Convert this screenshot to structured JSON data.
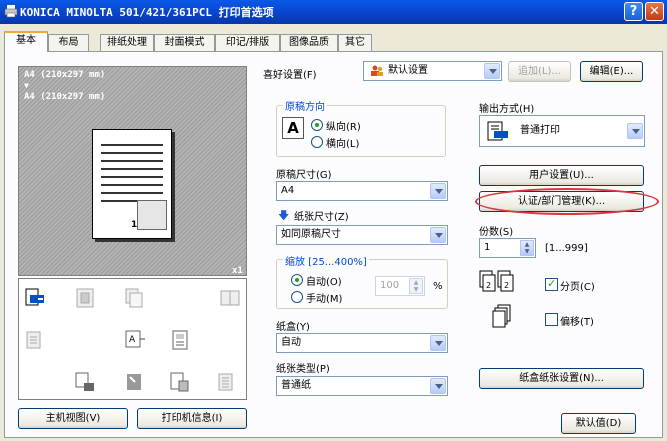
{
  "window": {
    "title": "KONICA MINOLTA 501/421/361PCL 打印首选项",
    "help_label": "?",
    "close_label": "✕"
  },
  "tabs": [
    {
      "label": "基本",
      "active": true
    },
    {
      "label": "布局"
    },
    {
      "label": "排纸处理"
    },
    {
      "label": "封面模式"
    },
    {
      "label": "印记/排版"
    },
    {
      "label": "图像品质"
    },
    {
      "label": "其它"
    }
  ],
  "preview": {
    "line1": "A4  (210x297 mm)",
    "arrow": "▼",
    "line2": "A4  (210x297 mm)",
    "page_number": "1",
    "copies_marker": "x1"
  },
  "favorites": {
    "label": "喜好设置(F)",
    "value": "默认设置",
    "add_label": "追加(L)...",
    "edit_label": "编辑(E)..."
  },
  "orientation": {
    "title": "原稿方向",
    "portrait": "纵向(R)",
    "landscape": "横向(L)",
    "selected": "portrait",
    "icon_letter": "A"
  },
  "original_size": {
    "label": "原稿尺寸(G)",
    "value": "A4"
  },
  "paper_size": {
    "label": "纸张尺寸(Z)",
    "value": "如同原稿尺寸"
  },
  "zoom": {
    "title": "缩放 [25...400%]",
    "auto": "自动(O)",
    "manual": "手动(M)",
    "value": "100",
    "unit": "%",
    "selected": "auto"
  },
  "paper_tray": {
    "label": "纸盒(Y)",
    "value": "自动"
  },
  "paper_type": {
    "label": "纸张类型(P)",
    "value": "普通纸"
  },
  "output": {
    "label": "输出方式(H)",
    "value": "普通打印"
  },
  "user_settings_label": "用户设置(U)...",
  "auth_label": "认证/部门管理(K)...",
  "copies": {
    "label": "份数(S)",
    "value": "1",
    "range": "[1...999]"
  },
  "collate": {
    "label": "分页(C)",
    "checked": true
  },
  "offset": {
    "label": "偏移(T)",
    "checked": false
  },
  "tray_settings_label": "纸盒纸张设置(N)...",
  "host_view_label": "主机视图(V)",
  "printer_info_label": "打印机信息(I)",
  "default_label": "默认值(D)"
}
